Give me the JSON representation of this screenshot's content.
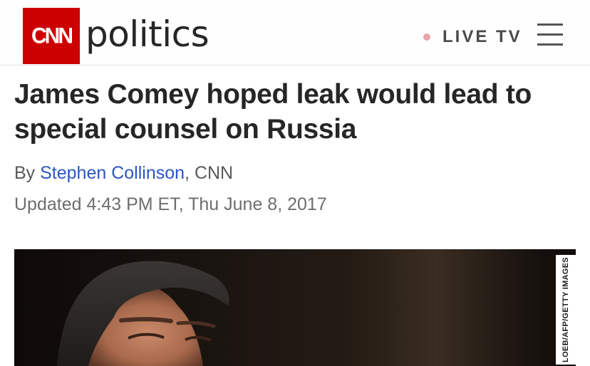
{
  "header": {
    "logo_text": "CNN",
    "section": "politics",
    "live_label": "LIVE TV",
    "menu_icon": "hamburger-menu-icon",
    "brand_color": "#cc0000"
  },
  "article": {
    "headline": "James Comey hoped leak would lead to special counsel on Russia",
    "byline_prefix": "By ",
    "author": "Stephen Collinson",
    "byline_suffix": ", CNN",
    "updated": "Updated 4:43 PM ET, Thu June 8, 2017"
  },
  "photo": {
    "credit": "LOEB/AFP/GETTY IMAGES"
  }
}
